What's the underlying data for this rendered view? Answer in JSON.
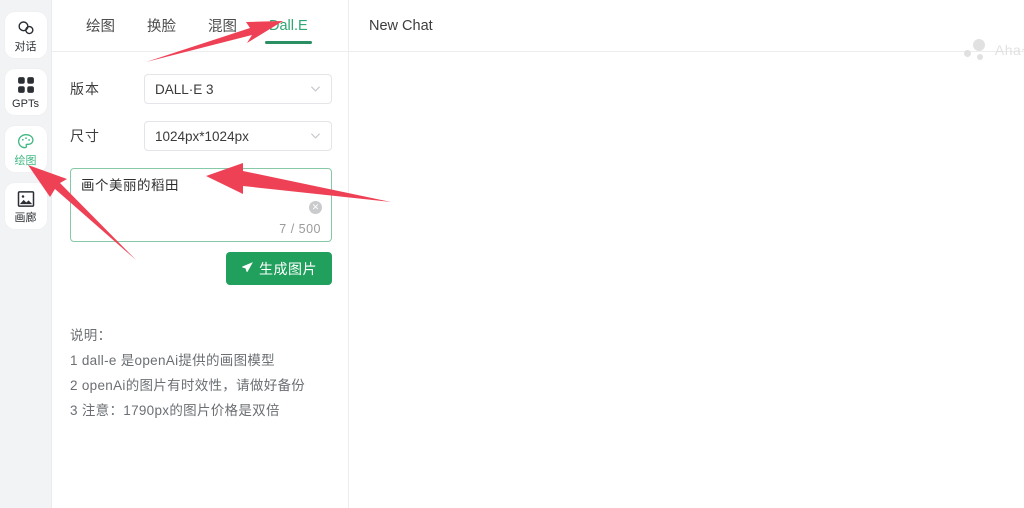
{
  "rail": {
    "items": [
      {
        "label": "对话",
        "icon": "chat-bubbles-icon",
        "active": false
      },
      {
        "label": "GPTs",
        "icon": "grid-squares-icon",
        "active": false
      },
      {
        "label": "绘图",
        "icon": "palette-icon",
        "active": true
      },
      {
        "label": "画廊",
        "icon": "image-frame-icon",
        "active": false
      }
    ]
  },
  "tabs": [
    {
      "label": "绘图",
      "active": false
    },
    {
      "label": "换脸",
      "active": false
    },
    {
      "label": "混图",
      "active": false
    },
    {
      "label": "Dall.E",
      "active": true
    }
  ],
  "form": {
    "version": {
      "label": "版本",
      "value": "DALL·E 3"
    },
    "size": {
      "label": "尺寸",
      "value": "1024px*1024px"
    },
    "prompt": {
      "value": "画个美丽的稻田",
      "placeholder": "",
      "counter": "7 / 500",
      "clear_icon": "close-circle-icon"
    },
    "generate_button": {
      "label": "生成图片",
      "icon": "send-plane-icon"
    }
  },
  "notes": {
    "title": "说明：",
    "lines": [
      "1 dall-e 是openAi提供的画图模型",
      "2 openAi的图片有时效性，请做好备份",
      "3 注意：1790px的图片价格是双倍"
    ]
  },
  "chat": {
    "title": "New Chat",
    "watermark": "Aha~"
  },
  "colors": {
    "accent_green": "#2fa673",
    "button_green": "#21a05d",
    "annotation_red": "#ef4155",
    "rail_bg": "#f2f3f5"
  }
}
